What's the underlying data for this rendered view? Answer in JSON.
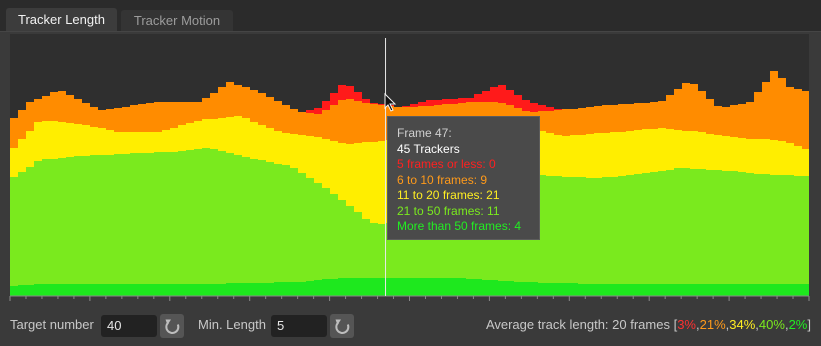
{
  "tabs": [
    {
      "label": "Tracker Length",
      "active": true
    },
    {
      "label": "Tracker Motion",
      "active": false
    }
  ],
  "chart_data": {
    "type": "area",
    "stacked": true,
    "x_ticks": [
      "20",
      "40",
      "60",
      "80",
      "100"
    ],
    "x_range": [
      0,
      100
    ],
    "current_frame": 47,
    "series": [
      {
        "name": "5 frames or less",
        "color": "#ff1a1a"
      },
      {
        "name": "6 to 10 frames",
        "color": "#ff8c00"
      },
      {
        "name": "11 to 20 frames",
        "color": "#ffee00"
      },
      {
        "name": "21 to 50 frames",
        "color": "#7aea1e"
      },
      {
        "name": "More than 50 frames",
        "color": "#1ee81e"
      }
    ]
  },
  "tooltip": {
    "frame": "Frame 47:",
    "total": "45 Trackers",
    "rows": [
      {
        "text": "5 frames or less: 0",
        "color": "#ff2020"
      },
      {
        "text": "6 to 10 frames: 9",
        "color": "#ff9a1a"
      },
      {
        "text": "11 to 20 frames: 21",
        "color": "#ffee22"
      },
      {
        "text": "21 to 50 frames: 11",
        "color": "#7aea1e"
      },
      {
        "text": "More than 50 frames: 4",
        "color": "#22ee22"
      }
    ]
  },
  "controls": {
    "target_label": "Target number",
    "target_value": "40",
    "minlen_label": "Min. Length",
    "minlen_value": "5"
  },
  "average": {
    "prefix": "Average track length: 20 frames [",
    "parts": [
      {
        "text": "3%",
        "color": "#ff3030"
      },
      {
        "text": ",",
        "color": "#c8c8c8"
      },
      {
        "text": "21%",
        "color": "#ff9a1a"
      },
      {
        "text": ",",
        "color": "#c8c8c8"
      },
      {
        "text": "34%",
        "color": "#ffee22"
      },
      {
        "text": ",",
        "color": "#c8c8c8"
      },
      {
        "text": "40%",
        "color": "#7aea1e"
      },
      {
        "text": ",",
        "color": "#c8c8c8"
      },
      {
        "text": "2%",
        "color": "#22ee22"
      }
    ],
    "suffix": "]"
  }
}
